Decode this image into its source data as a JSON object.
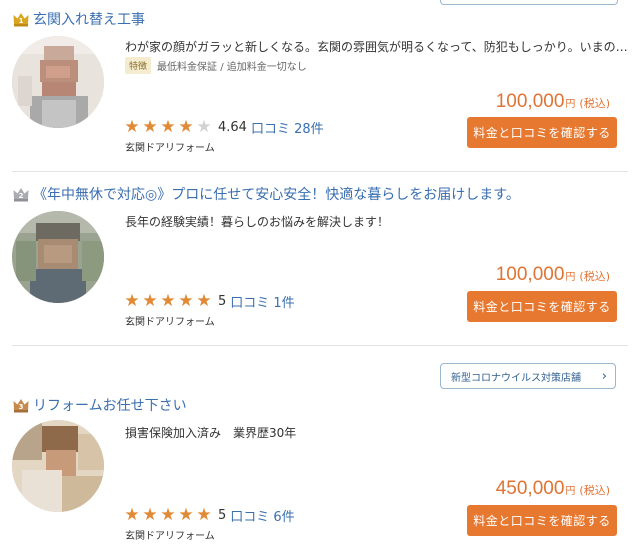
{
  "listings": [
    {
      "rank": "1",
      "title": "玄関入れ替え工事",
      "description": "わが家の顔がガラッと新しくなる。玄関の雰囲気が明るくなって、防犯もしっかり。いまの…",
      "feature_label": "特徴",
      "feature_text": "最低料金保証 / 追加料金一切なし",
      "rating": "4.64",
      "stars": 4,
      "review_link": "口コミ 28件",
      "category": "玄関ドアリフォーム",
      "price": "100,000",
      "yen": "円",
      "tax": "(税込)",
      "cta": "料金と口コミを確認する"
    },
    {
      "rank": "2",
      "title": "《年中無休で対応◎》プロに任せて安心安全！快適な暮らしをお届けします。",
      "description": "長年の経験実績！暮らしのお悩みを解決します！",
      "rating": "5",
      "stars": 5,
      "review_link": "口コミ 1件",
      "category": "玄関ドアリフォーム",
      "price": "100,000",
      "yen": "円",
      "tax": "(税込)",
      "cta": "料金と口コミを確認する"
    },
    {
      "rank": "3",
      "title": "リフォームお任せ下さい",
      "description": "損害保険加入済み　業界歴30年",
      "rating": "5",
      "stars": 5,
      "review_link": "口コミ 6件",
      "category": "玄関ドアリフォーム",
      "price": "450,000",
      "yen": "円",
      "tax": "(税込)",
      "cta": "料金と口コミを確認する",
      "badge_link": "新型コロナウイルス対策店舗"
    }
  ],
  "colors": {
    "accent": "#e7782f",
    "link": "#3a6fb0",
    "gold": "#d9a520",
    "silver": "#a9acb0",
    "bronze": "#c58a4e"
  }
}
